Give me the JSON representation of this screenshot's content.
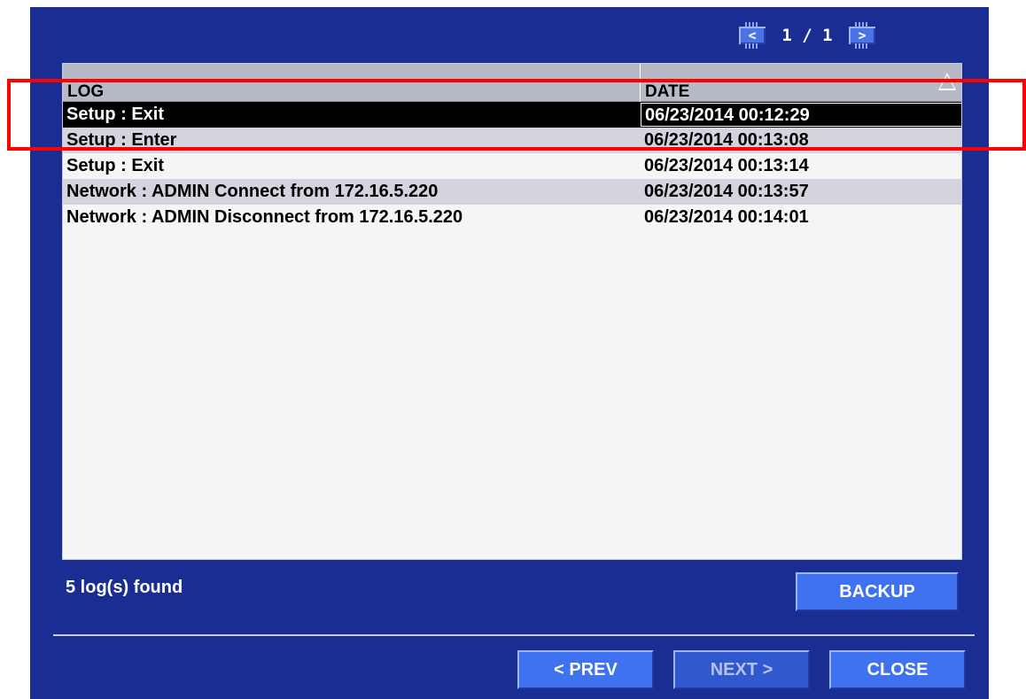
{
  "pager": {
    "prev_icon": "<",
    "next_icon": ">",
    "text": "1 / 1"
  },
  "table": {
    "columns": [
      "LOG",
      "DATE"
    ],
    "rows": [
      {
        "log": "Setup : Exit",
        "date": "06/23/2014 00:12:29"
      },
      {
        "log": "Setup : Enter",
        "date": "06/23/2014 00:13:08"
      },
      {
        "log": "Setup : Exit",
        "date": "06/23/2014 00:13:14"
      },
      {
        "log": "Network : ADMIN Connect from 172.16.5.220",
        "date": "06/23/2014 00:13:57"
      },
      {
        "log": "Network : ADMIN Disconnect from 172.16.5.220",
        "date": "06/23/2014 00:14:01"
      }
    ]
  },
  "status": {
    "found": "5 log(s) found"
  },
  "buttons": {
    "backup": "BACKUP",
    "prev": "< PREV",
    "next": "NEXT >",
    "close": "CLOSE"
  },
  "colors": {
    "window_bg": "#1a2d93",
    "button_bg": "#3e72f0",
    "selection_bg": "#000000",
    "highlight_frame": "#ff0000"
  }
}
